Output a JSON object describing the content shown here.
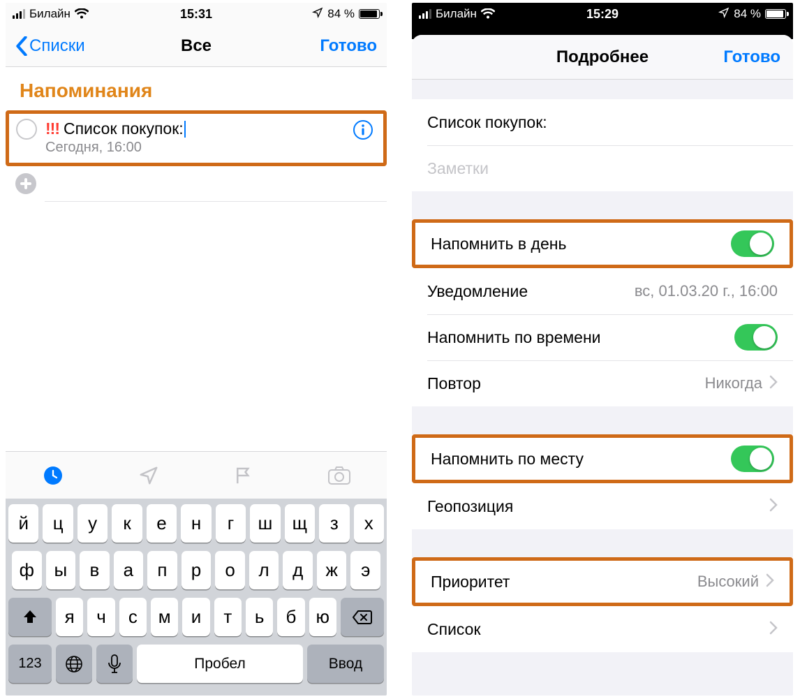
{
  "left": {
    "status": {
      "carrier": "Билайн",
      "time": "15:31",
      "battery": "84 %"
    },
    "nav": {
      "back": "Списки",
      "title": "Все",
      "done": "Готово"
    },
    "list_title": "Напоминания",
    "reminder": {
      "priority_mark": "!!!",
      "title": "Список покупок:",
      "subtitle": "Сегодня, 16:00"
    },
    "keyboard": {
      "row1": [
        "й",
        "ц",
        "у",
        "к",
        "е",
        "н",
        "г",
        "ш",
        "щ",
        "з",
        "х"
      ],
      "row2": [
        "ф",
        "ы",
        "в",
        "а",
        "п",
        "р",
        "о",
        "л",
        "д",
        "ж",
        "э"
      ],
      "row3": [
        "я",
        "ч",
        "с",
        "м",
        "и",
        "т",
        "ь",
        "б",
        "ю"
      ],
      "num": "123",
      "space": "Пробел",
      "enter": "Ввод"
    }
  },
  "right": {
    "status": {
      "carrier": "Билайн",
      "time": "15:29",
      "battery": "84 %"
    },
    "sheet": {
      "title": "Подробнее",
      "done": "Готово"
    },
    "fields": {
      "title_value": "Список покупок:",
      "notes_placeholder": "Заметки",
      "remind_day": "Напомнить в день",
      "notification": "Уведомление",
      "notification_value": "вс, 01.03.20 г., 16:00",
      "remind_time": "Напомнить по времени",
      "repeat": "Повтор",
      "repeat_value": "Никогда",
      "remind_place": "Напомнить по месту",
      "geoposition": "Геопозиция",
      "priority": "Приоритет",
      "priority_value": "Высокий",
      "list": "Список"
    }
  }
}
